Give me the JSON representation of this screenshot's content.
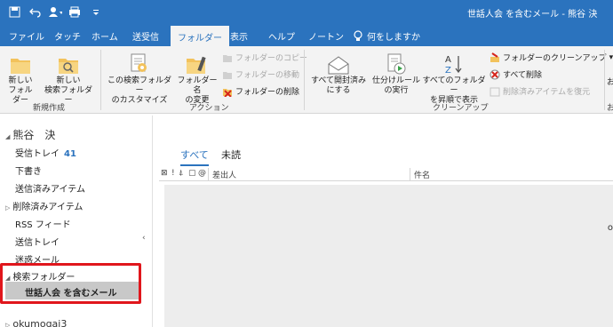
{
  "window": {
    "title": "世話人会 を含むメール - 熊谷 決"
  },
  "qat": {
    "icons": [
      "save-icon",
      "undo-icon",
      "send-receive-icon",
      "print-icon",
      "customize-icon"
    ]
  },
  "ribbon_tabs": [
    "ファイル",
    "タッチ",
    "ホーム",
    "送受信",
    "フォルダー",
    "表示",
    "ヘルプ",
    "ノートン"
  ],
  "tell_me": "何をしますか",
  "groups": {
    "new": {
      "label": "新規作成",
      "buttons": [
        [
          "新しい",
          "フォルダー"
        ],
        [
          "新しい",
          "検索フォルダー"
        ]
      ]
    },
    "actions": {
      "label": "アクション",
      "buttons": [
        [
          "この検索フォルダー",
          "のカスタマイズ"
        ],
        [
          "フォルダー名",
          "の変更"
        ]
      ],
      "small": [
        "フォルダーのコピー",
        "フォルダーの移動",
        "フォルダーの削除"
      ]
    },
    "cleanup": {
      "label": "クリーンアップ",
      "buttons": [
        [
          "すべて開封済み",
          "にする"
        ],
        [
          "仕分けルール",
          "の実行"
        ],
        [
          "すべてのフォルダー",
          "を昇順で表示"
        ]
      ],
      "small": [
        "フォルダーのクリーンアップ",
        "すべて削除",
        "削除済みアイテムを復元"
      ]
    },
    "edge": [
      "お",
      "お"
    ]
  },
  "nav": {
    "account": "熊谷　決",
    "items": [
      "受信トレイ",
      "下書き",
      "送信済みアイテム",
      "削除済みアイテム",
      "RSS フィード",
      "送信トレイ",
      "迷惑メール",
      "検索フォルダー"
    ],
    "inbox_count": "41",
    "selected": "世話人会 を含むメール",
    "second_account": "okumogai3"
  },
  "filters": {
    "all": "すべて",
    "unread": "未読"
  },
  "columns": {
    "from": "差出人",
    "subject": "件名"
  },
  "edge_char": "o",
  "colors": {
    "accent": "#2b73be",
    "highlight": "#e0161c"
  }
}
